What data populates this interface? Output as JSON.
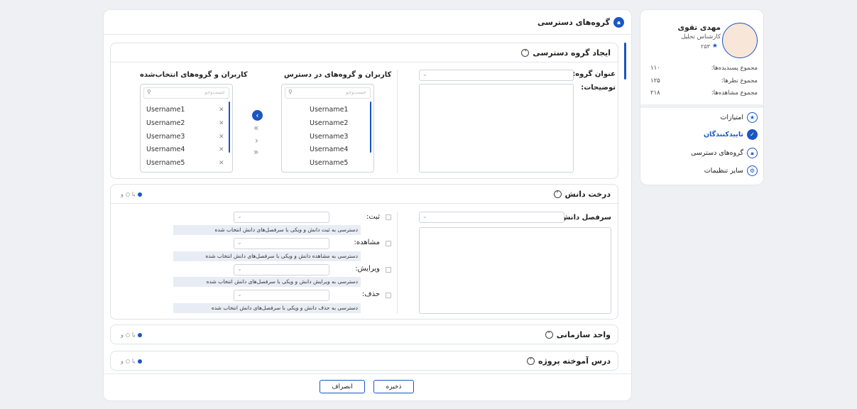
{
  "profile": {
    "name": "مهدی تقوی",
    "role": "کارشناس تحلیل",
    "score": "۲۵۳",
    "stats": [
      {
        "label": "مجموع پسندیده‌ها:",
        "value": "۱۱۰"
      },
      {
        "label": "مجموع نظرها:",
        "value": "۱۲۵"
      },
      {
        "label": "مجموع مشاهده‌ها:",
        "value": "۲۱۸"
      }
    ],
    "menu": [
      {
        "label": "امتیازات",
        "icon": "star-icon",
        "active": false
      },
      {
        "label": "تاییدکنندگان",
        "icon": "check-icon",
        "active": true
      },
      {
        "label": "گروه‌های دسترسی",
        "icon": "lock-icon",
        "active": false
      },
      {
        "label": "سایر تنظیمات",
        "icon": "gear-icon",
        "active": false
      }
    ]
  },
  "page": {
    "title": "گروه‌های دسترسی"
  },
  "create_section": {
    "title": "ایجاد گروه دسترسی",
    "group_name_label": "عنوان گروه:",
    "description_label": "توضیحات:",
    "available_title": "کاربران و گروه‌های در دسترس",
    "selected_title": "کاربران و گروه‌های انتخاب‌شده",
    "search_placeholder": "جست‌وجو",
    "available_users": [
      "Username1",
      "Username2",
      "Username3",
      "Username4",
      "Username5"
    ],
    "selected_users": [
      "Username1",
      "Username2",
      "Username3",
      "Username4",
      "Username5"
    ],
    "transfer_buttons": [
      "‹",
      "«",
      "›",
      "»"
    ]
  },
  "tree_section": {
    "title": "درخت دانش",
    "and_label": "و",
    "or_label": "یا",
    "heading_label": "سرفصل دانش",
    "permissions": [
      {
        "label": "ثبت:",
        "note": "دسترسی به ثبت دانش و ویکی با سرفصل‌های دانش انتخاب شده"
      },
      {
        "label": "مشاهده:",
        "note": "دسترسی به مشاهده دانش و ویکی با سرفصل‌های دانش انتخاب شده"
      },
      {
        "label": "ویرایش:",
        "note": "دسترسی به ویرایش دانش و ویکی با سرفصل‌های دانش انتخاب شده"
      },
      {
        "label": "حذف:",
        "note": "دسترسی به حذف دانش و ویکی با سرفصل‌های دانش انتخاب شده"
      }
    ]
  },
  "org_section": {
    "title": "واحد سازمانی",
    "and_label": "و",
    "or_label": "یا"
  },
  "lesson_section": {
    "title": "درس آموخته پروژه",
    "and_label": "و",
    "or_label": "یا"
  },
  "footer": {
    "save_label": "ذخیره",
    "cancel_label": "انصراف"
  },
  "colors": {
    "accent": "#1a56c4",
    "note_bg": "#e8edf5"
  }
}
